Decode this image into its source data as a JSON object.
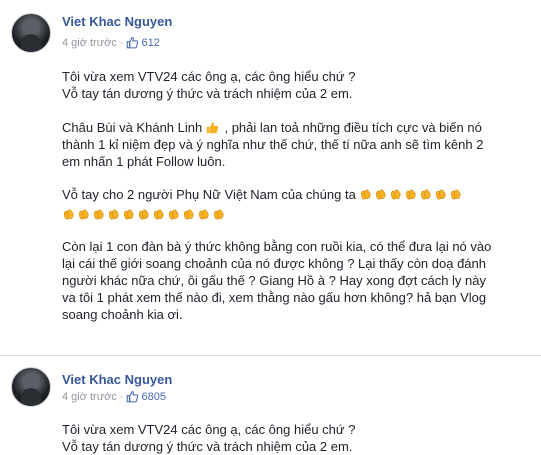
{
  "posts": [
    {
      "author": "Viet Khac Nguyen",
      "time": "4 giờ trước",
      "separator": "·",
      "likes": "612",
      "lines": {
        "l1": "Tôi vừa xem VTV24 các ông ạ, các ông hiểu chứ ?",
        "l2": "Vỗ tay tán dương ý thức và trách nhiệm của 2 em.",
        "l3a": "Châu Bùi và Khánh Linh",
        "l3b": ", phải lan toả những điều tích cực và biến nó",
        "l4": "thành 1 kỉ niệm đẹp và ý nghĩa như thế chứ, thế tí nữa anh sẽ tìm kênh 2",
        "l5": "em nhấn 1 phát Follow luôn.",
        "l6": "Vỗ tay cho 2 người Phụ Nữ Việt Nam của chúng ta",
        "l7": "Còn lại 1 con đàn bà ý thức không bằng con ruồi kia, có thể đưa lại nó vào",
        "l8": "lại cái thế giới soang choảnh của nó được không ? Lại thấy còn doạ đánh",
        "l9": "người khác nữa chứ, ôi gấu thế ? Giang Hồ à ? Hay xong đợt cách ly này",
        "l10": "va tôi 1 phát xem thế nào đi, xem thằng nào gấu hơn không? hả bạn Vlog",
        "l11": "soang choảnh kia ơi."
      },
      "emoji": {
        "thumb": "thumbs-up-emoji",
        "clap": "clapping-hands-emoji",
        "clap_count_line1": 7,
        "clap_count_line2": 11
      }
    },
    {
      "author": "Viet Khac Nguyen",
      "time": "4 giờ trước",
      "separator": "·",
      "likes": "6805",
      "lines": {
        "l1": "Tôi vừa xem VTV24 các ông ạ, các ông hiểu chứ ?",
        "l2": "Vỗ tay tán dương ý thức và trách nhiệm của 2 em."
      }
    }
  ],
  "colors": {
    "name": "#365899",
    "meta": "#90949c",
    "like": "#4267b2",
    "emoji": "#f7b125"
  },
  "icons": {
    "like": "thumbs-up-icon",
    "avatar": "avatar-photo"
  }
}
